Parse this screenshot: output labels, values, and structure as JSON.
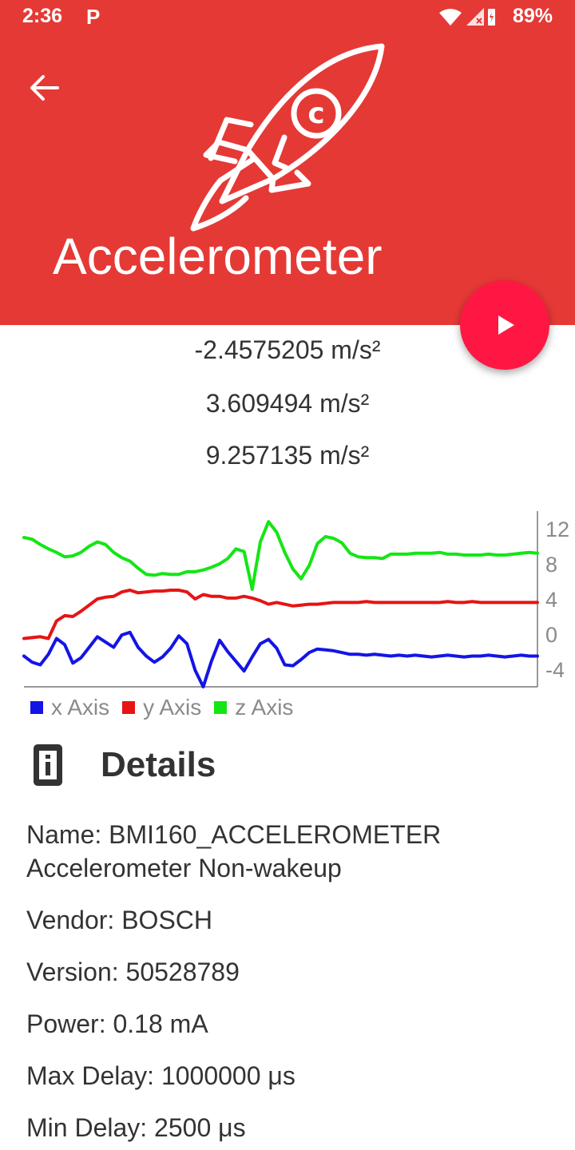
{
  "status_bar": {
    "time": "2:36",
    "notification_app": "P",
    "battery": "89%"
  },
  "header": {
    "title": "Accelerometer",
    "background_color": "#e53935",
    "back_icon": "arrow-left-icon",
    "hero_icon": "rocket-icon"
  },
  "fab": {
    "icon": "play-icon",
    "color": "#ff1744"
  },
  "readings": {
    "x": "-2.4575205 m/s²",
    "y": "3.609494 m/s²",
    "z": "9.257135 m/s²"
  },
  "chart_data": {
    "type": "line",
    "y_ticks": [
      "12",
      "8",
      "4",
      "0",
      "-4"
    ],
    "ylim": [
      -6,
      14
    ],
    "xlim": [
      0,
      64
    ],
    "series": [
      {
        "name": "x Axis",
        "color": "#1414e6",
        "values": [
          -2.5,
          -3.2,
          -3.5,
          -2.3,
          -0.5,
          -1.2,
          -3.3,
          -2.7,
          -1.5,
          -0.3,
          -0.9,
          -1.5,
          -0.1,
          0.2,
          -1.5,
          -2.5,
          -3.2,
          -2.6,
          -1.6,
          -0.2,
          -1.1,
          -4.1,
          -6.0,
          -3.1,
          -0.7,
          -2.0,
          -3.1,
          -4.2,
          -2.6,
          -1.1,
          -0.6,
          -1.6,
          -3.5,
          -3.6,
          -2.9,
          -2.1,
          -1.7,
          -1.8,
          -1.9,
          -2.1,
          -2.3,
          -2.3,
          -2.4,
          -2.3,
          -2.4,
          -2.5,
          -2.4,
          -2.5,
          -2.4,
          -2.5,
          -2.6,
          -2.5,
          -2.4,
          -2.5,
          -2.6,
          -2.5,
          -2.5,
          -2.4,
          -2.5,
          -2.6,
          -2.5,
          -2.4,
          -2.5,
          -2.5
        ]
      },
      {
        "name": "y Axis",
        "color": "#e61414",
        "values": [
          -0.5,
          -0.4,
          -0.3,
          -0.5,
          1.5,
          2.1,
          2.0,
          2.6,
          3.3,
          4.0,
          4.2,
          4.3,
          4.8,
          5.0,
          4.7,
          4.8,
          4.9,
          4.9,
          5.0,
          5.0,
          4.8,
          4.0,
          4.5,
          4.3,
          4.3,
          4.1,
          4.1,
          4.3,
          4.1,
          3.8,
          3.4,
          3.6,
          3.4,
          3.2,
          3.3,
          3.4,
          3.4,
          3.5,
          3.6,
          3.6,
          3.6,
          3.6,
          3.7,
          3.6,
          3.6,
          3.6,
          3.6,
          3.6,
          3.6,
          3.6,
          3.6,
          3.6,
          3.7,
          3.6,
          3.6,
          3.7,
          3.6,
          3.6,
          3.6,
          3.6,
          3.6,
          3.6,
          3.6,
          3.6
        ]
      },
      {
        "name": "z Axis",
        "color": "#14e614",
        "values": [
          11.0,
          10.8,
          10.2,
          9.7,
          9.3,
          8.8,
          8.9,
          9.3,
          10.0,
          10.5,
          10.2,
          9.3,
          8.7,
          8.3,
          7.5,
          6.8,
          6.7,
          6.9,
          6.8,
          6.8,
          7.1,
          7.1,
          7.3,
          7.6,
          8.0,
          8.6,
          9.7,
          9.4,
          5.1,
          10.5,
          12.8,
          11.6,
          9.3,
          7.4,
          6.3,
          7.8,
          10.3,
          11.1,
          10.9,
          10.4,
          9.2,
          8.8,
          8.7,
          8.7,
          8.6,
          9.1,
          9.1,
          9.1,
          9.2,
          9.2,
          9.2,
          9.3,
          9.1,
          9.1,
          9.0,
          9.0,
          9.0,
          9.1,
          9.0,
          9.0,
          9.1,
          9.2,
          9.3,
          9.2
        ]
      }
    ],
    "grid": false,
    "legend_position": "bottom-left"
  },
  "details": {
    "heading": "Details",
    "icon": "info-card-icon",
    "name": "Name:  BMI160_ACCELEROMETER\nAccelerometer Non-wakeup",
    "vendor": "Vendor:  BOSCH",
    "version": "Version:  50528789",
    "power": "Power:  0.18 mA",
    "max_delay": "Max Delay:  1000000 μs",
    "min_delay": "Min Delay:  2500 μs"
  }
}
